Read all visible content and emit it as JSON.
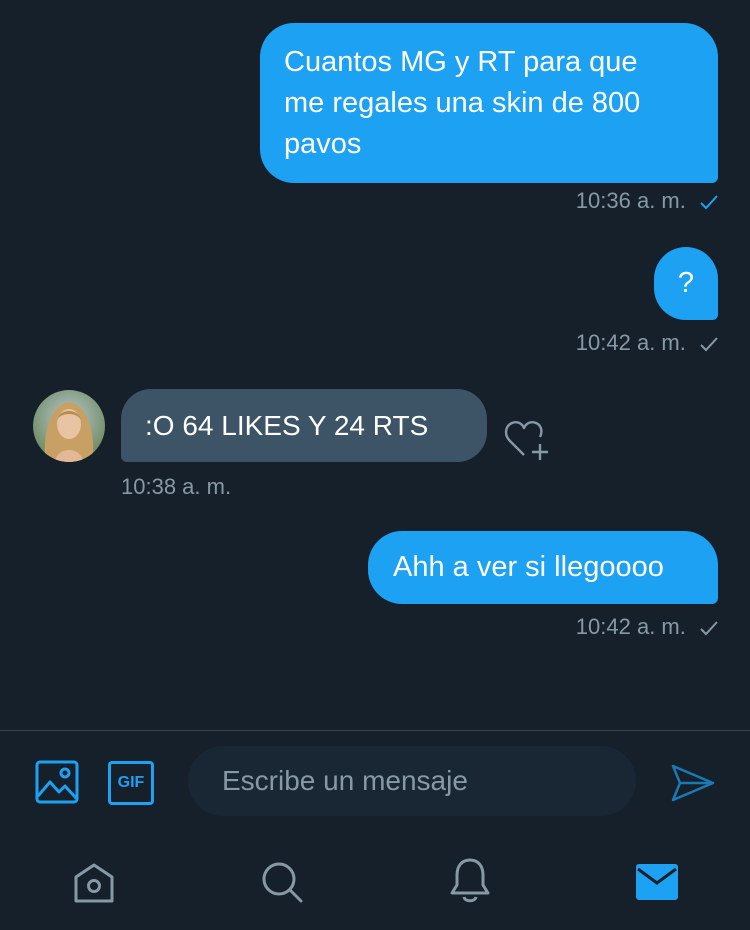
{
  "messages": [
    {
      "direction": "outgoing",
      "lines": [
        "Cuantos MG y RT para que",
        "me regales una skin de 800",
        "pavos"
      ],
      "time": "10:36 a. m.",
      "read": true
    },
    {
      "direction": "outgoing",
      "text": "?",
      "time": "10:42 a. m.",
      "read": false
    },
    {
      "direction": "incoming",
      "text": ":O 64 LIKES Y 24 RTS",
      "time": "10:38 a. m."
    },
    {
      "direction": "outgoing",
      "text": "Ahh a ver si llegoooo",
      "time": "10:42 a. m.",
      "read": false
    }
  ],
  "composer": {
    "placeholder": "Escribe un mensaje",
    "gif_label": "GIF",
    "icons": [
      "image-icon",
      "gif-icon",
      "send-icon"
    ]
  },
  "tabbar": {
    "items": [
      {
        "name": "home",
        "icon": "home-icon"
      },
      {
        "name": "search",
        "icon": "search-icon"
      },
      {
        "name": "notifications",
        "icon": "bell-icon"
      },
      {
        "name": "messages",
        "icon": "mail-icon",
        "active": true
      }
    ]
  },
  "colors": {
    "background": "#15202b",
    "accent": "#1da1f2",
    "incoming_bubble": "#3d5466",
    "muted": "#8899a6",
    "input_bg": "#192734"
  }
}
